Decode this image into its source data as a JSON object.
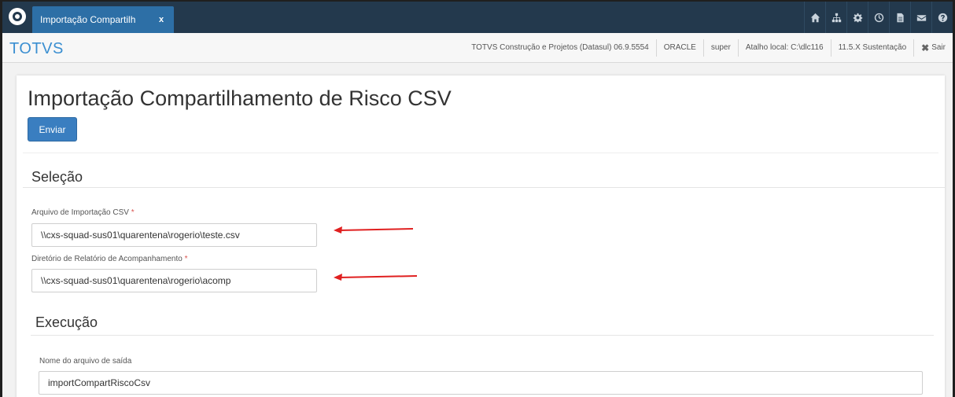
{
  "tab": {
    "label": "Importação Compartilh",
    "close": "x"
  },
  "toolbar_icons": [
    "home-icon",
    "sitemap-icon",
    "gear-icon",
    "clock-icon",
    "document-icon",
    "mail-icon",
    "help-icon"
  ],
  "header": {
    "logo": "TOTVS",
    "product": "TOTVS Construção e Projetos (Datasul) 06.9.5554",
    "database": "ORACLE",
    "user": "super",
    "shortcut": "Atalho local: C:\\dlc116",
    "environment": "11.5.X Sustentação",
    "exit_label": "Sair"
  },
  "page": {
    "title": "Importação Compartilhamento de Risco CSV",
    "send_button": "Enviar"
  },
  "selection": {
    "title": "Seleção",
    "csv_label": "Arquivo de Importação CSV",
    "csv_value": "\\\\cxs-squad-sus01\\quarentena\\rogerio\\teste.csv",
    "report_dir_label": "Diretório de Relatório de Acompanhamento",
    "report_dir_value": "\\\\cxs-squad-sus01\\quarentena\\rogerio\\acomp",
    "required_mark": "*"
  },
  "execution": {
    "title": "Execução",
    "output_label": "Nome do arquivo de saída",
    "output_value": "importCompartRiscoCsv"
  },
  "colors": {
    "topbar": "#23394d",
    "tab": "#2d6fa6",
    "logo": "#3b8fd1",
    "button": "#3a7ec0",
    "arrow": "#e02020"
  }
}
